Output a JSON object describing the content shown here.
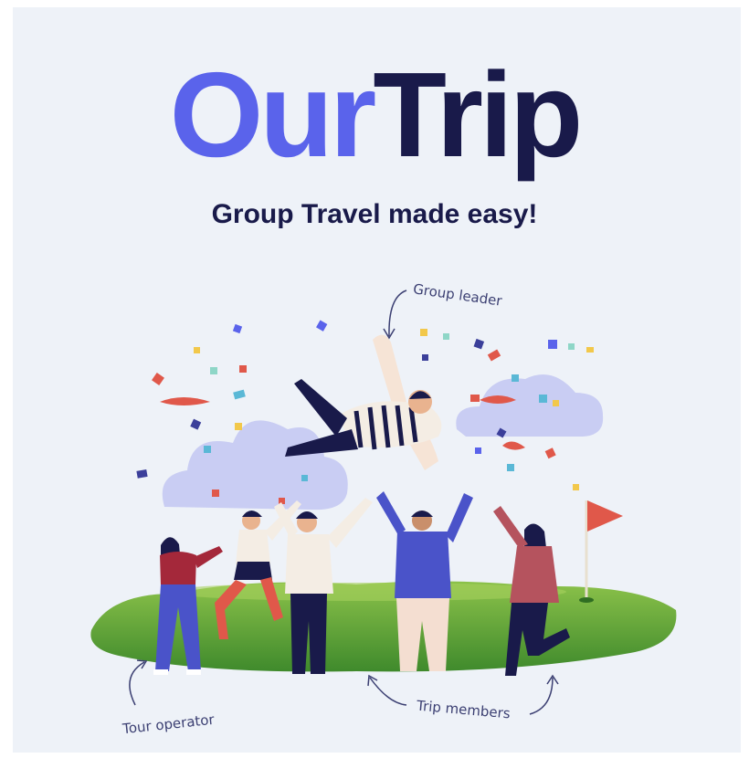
{
  "brand": {
    "part1": "Our",
    "part2": "Trip",
    "accent_color": "#5a63eb",
    "dark_color": "#191a4a"
  },
  "tagline": "Group Travel made easy!",
  "annotations": {
    "group_leader": "Group leader",
    "tour_operator": "Tour operator",
    "trip_members": "Trip members"
  }
}
